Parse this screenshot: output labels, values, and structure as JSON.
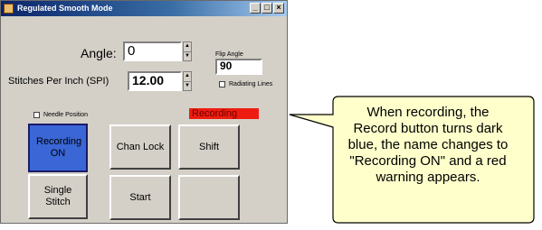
{
  "window": {
    "title": "Regulated Smooth Mode",
    "minimize_glyph": "_",
    "maximize_glyph": "□",
    "close_glyph": "×"
  },
  "angle": {
    "label": "Angle:",
    "value": "0"
  },
  "spi": {
    "label": "Stitches Per Inch (SPI)",
    "value": "12.00"
  },
  "flip_angle": {
    "label": "Flip Angle",
    "value": "90"
  },
  "radiating_lines": {
    "label": "Radiating Lines",
    "checked": false
  },
  "needle_position": {
    "label": "Needle Position",
    "checked": false
  },
  "recording_warning": "Recording",
  "buttons": {
    "recording": "Recording ON",
    "chan_lock": "Chan Lock",
    "shift": "Shift",
    "single_stitch": "Single Stitch",
    "start": "Start",
    "blank": ""
  },
  "colors": {
    "active_button": "#3a66d6",
    "warning": "#ee1c10",
    "callout_fill": "#ffffcc"
  },
  "callout": {
    "lines": [
      "When recording, the",
      "Record button turns dark",
      "blue, the name changes to",
      "\"Recording ON\" and a red",
      "warning appears."
    ]
  }
}
